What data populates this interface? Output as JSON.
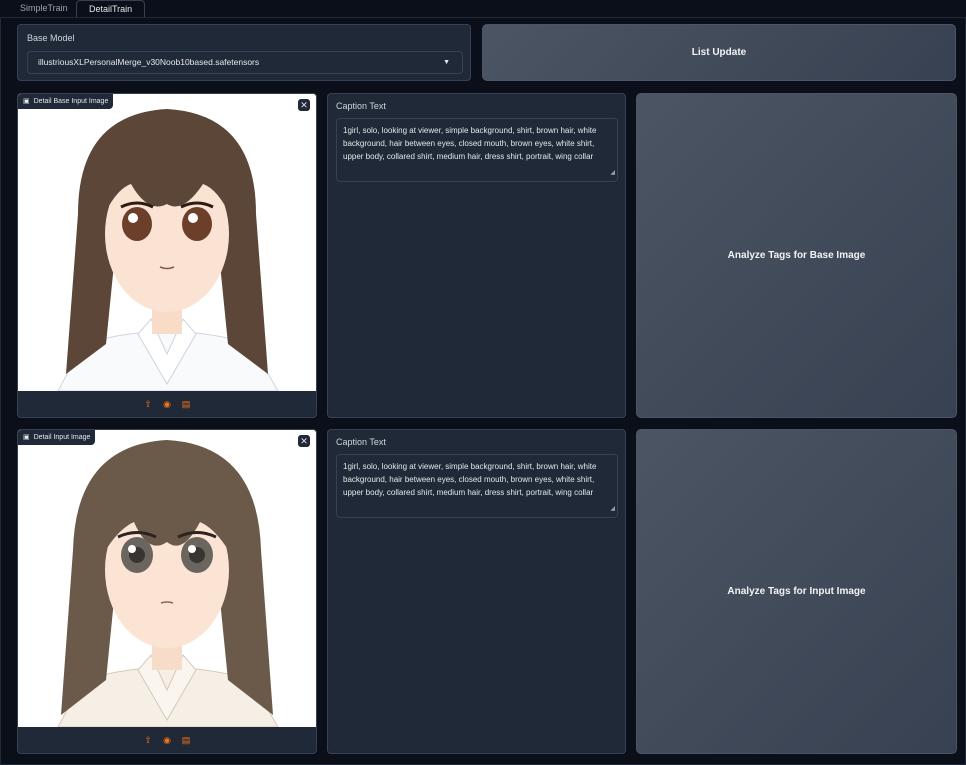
{
  "tabs": [
    {
      "label": "SimpleTrain",
      "active": false
    },
    {
      "label": "DetailTrain",
      "active": true
    }
  ],
  "base_model": {
    "label": "Base Model",
    "value": "illustriousXLPersonalMerge_v30Noob10based.safetensors"
  },
  "list_update_label": "List Update",
  "rows": [
    {
      "image_label": "Detail Base Input Image",
      "caption_label": "Caption Text",
      "caption_text": "1girl, solo, looking at viewer, simple background, shirt, brown hair, white background, hair between eyes, closed mouth, brown eyes, white shirt, upper body, collared shirt, medium hair, dress shirt, portrait, wing collar",
      "analyze_label": "Analyze Tags for Base Image",
      "hair_color": "#5b4638",
      "eye_color": "#6b3f2a",
      "shirt_color": "#f8fafc"
    },
    {
      "image_label": "Detail Input Image",
      "caption_label": "Caption Text",
      "caption_text": "1girl, solo, looking at viewer, simple background, shirt, brown hair, white background, hair between eyes, closed mouth, brown eyes, white shirt, upper body, collared shirt, medium hair, dress shirt, portrait, wing collar",
      "analyze_label": "Analyze Tags for Input Image",
      "hair_color": "#6b5a4a",
      "eye_color": "#6b6560",
      "shirt_color": "#f5efe6"
    }
  ],
  "icons": {
    "close": "close-icon",
    "image": "image-icon",
    "upload": "upload-icon",
    "webcam": "webcam-icon",
    "clipboard": "clipboard-icon"
  },
  "colors": {
    "background": "#0b0f19",
    "panel": "#1f2937",
    "border": "#374151",
    "accent": "#f97316"
  }
}
